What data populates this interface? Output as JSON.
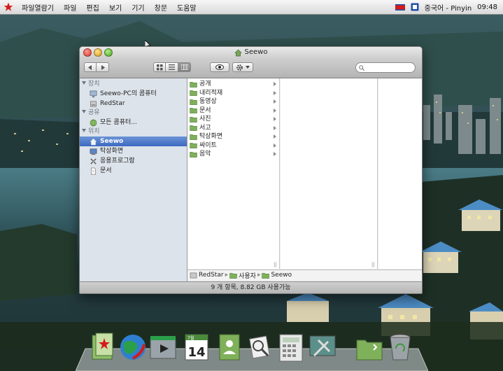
{
  "menubar": {
    "app_name": "파일열람기",
    "menus": [
      "파일",
      "편집",
      "보기",
      "기기",
      "창문",
      "도움말"
    ],
    "input_method": "중국어 - Pinyin",
    "clock": "09:48"
  },
  "window": {
    "title": "Seewo",
    "search_placeholder": "",
    "status": "9 개 항목, 8.82 GB 사용가능"
  },
  "sidebar": {
    "sections": [
      {
        "label": "장치",
        "items": [
          {
            "label": "Seewo-PC의 콤퓨터",
            "icon": "computer-icon"
          },
          {
            "label": "RedStar",
            "icon": "disk-icon"
          }
        ]
      },
      {
        "label": "공유",
        "items": [
          {
            "label": "모든 콤퓨터...",
            "icon": "network-icon"
          }
        ]
      },
      {
        "label": "위치",
        "items": [
          {
            "label": "Seewo",
            "icon": "home-icon"
          },
          {
            "label": "탁상화면",
            "icon": "desktop-icon"
          },
          {
            "label": "응용프로그람",
            "icon": "applications-icon"
          },
          {
            "label": "문서",
            "icon": "document-icon"
          }
        ]
      }
    ]
  },
  "column1": [
    {
      "label": "공개"
    },
    {
      "label": "내리적재"
    },
    {
      "label": "동영상"
    },
    {
      "label": "문서"
    },
    {
      "label": "사진"
    },
    {
      "label": "서고"
    },
    {
      "label": "탁상화면"
    },
    {
      "label": "싸이트"
    },
    {
      "label": "음악"
    }
  ],
  "pathbar": [
    "RedStar",
    "사용자",
    "Seewo"
  ],
  "dock": {
    "calendar_month": "7월",
    "calendar_day": "14"
  },
  "colors": {
    "selection": "#3d6ac1",
    "folder": "#7fb05a",
    "menubar_star": "#d41a1a"
  }
}
